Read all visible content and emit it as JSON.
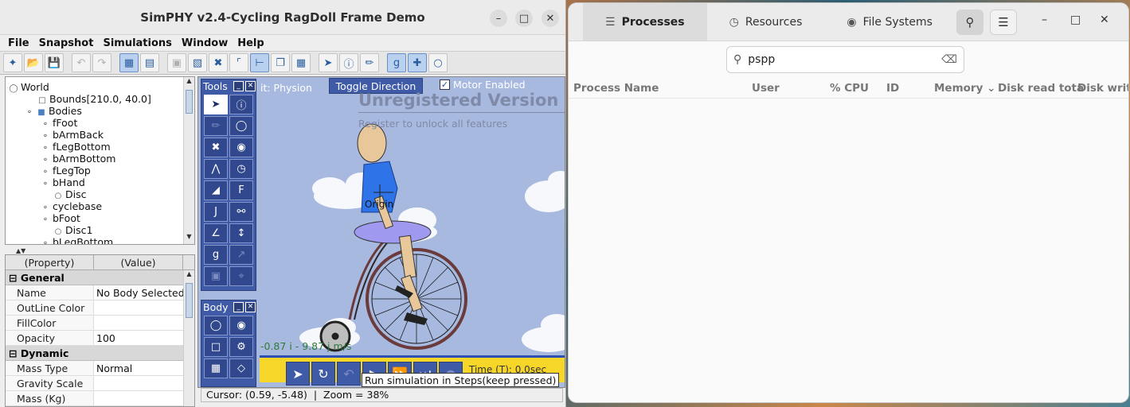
{
  "simphy": {
    "title": "SimPHY v2.4-Cycling RagDoll Frame Demo",
    "menu": [
      "File",
      "Snapshot",
      "Simulations",
      "Window",
      "Help"
    ],
    "tree": [
      {
        "label": "World",
        "level": 0
      },
      {
        "label": "Bounds[210.0, 40.0]",
        "level": 1
      },
      {
        "label": "Bodies",
        "level": 1
      },
      {
        "label": "fFoot",
        "level": 2
      },
      {
        "label": "bArmBack",
        "level": 2
      },
      {
        "label": "fLegBottom",
        "level": 2
      },
      {
        "label": "bArmBottom",
        "level": 2
      },
      {
        "label": "fLegTop",
        "level": 2
      },
      {
        "label": "bHand",
        "level": 2
      },
      {
        "label": "Disc",
        "level": 2
      },
      {
        "label": "cyclebase",
        "level": 2
      },
      {
        "label": "bFoot",
        "level": 2
      },
      {
        "label": "Disc1",
        "level": 2
      },
      {
        "label": "bLegBottom",
        "level": 2
      }
    ],
    "props": {
      "col_property": "(Property)",
      "col_value": "(Value)",
      "sections": [
        {
          "name": "General",
          "rows": [
            {
              "k": "Name",
              "v": "No Body Selected"
            },
            {
              "k": "OutLine Color",
              "v": ""
            },
            {
              "k": "FillColor",
              "v": ""
            },
            {
              "k": "Opacity",
              "v": "100"
            }
          ]
        },
        {
          "name": "Dynamic",
          "rows": [
            {
              "k": "Mass Type",
              "v": "Normal"
            },
            {
              "k": "Gravity Scale",
              "v": ""
            },
            {
              "k": "Mass (Kg)",
              "v": ""
            }
          ]
        }
      ]
    },
    "canvas": {
      "unit_text": "it: Physion",
      "toggle_label": "Toggle Direction",
      "motor_label": "Motor Enabled",
      "unregistered_title": "Unregistered Version",
      "unregistered_sub": "Register to unlock all features",
      "origin_label": "Origin",
      "vector_text": "-0.87 i - 9.87 j m/s",
      "time_text": "Time (T): 0.0sec",
      "tooltip": "Run simulation in Steps(keep pressed)",
      "tools_title": "Tools",
      "body_title": "Body"
    },
    "status": {
      "cursor": "Cursor: (0.59, -5.48)",
      "zoom": "Zoom = 38%"
    }
  },
  "sysmon": {
    "tabs": [
      {
        "label": "Processes",
        "icon": "list-icon"
      },
      {
        "label": "Resources",
        "icon": "gauge-icon"
      },
      {
        "label": "File Systems",
        "icon": "disk-icon"
      }
    ],
    "search_value": "pspp",
    "columns": [
      "Process Name",
      "User",
      "% CPU",
      "ID",
      "Memory",
      "Disk read tota",
      "Disk writ"
    ]
  }
}
